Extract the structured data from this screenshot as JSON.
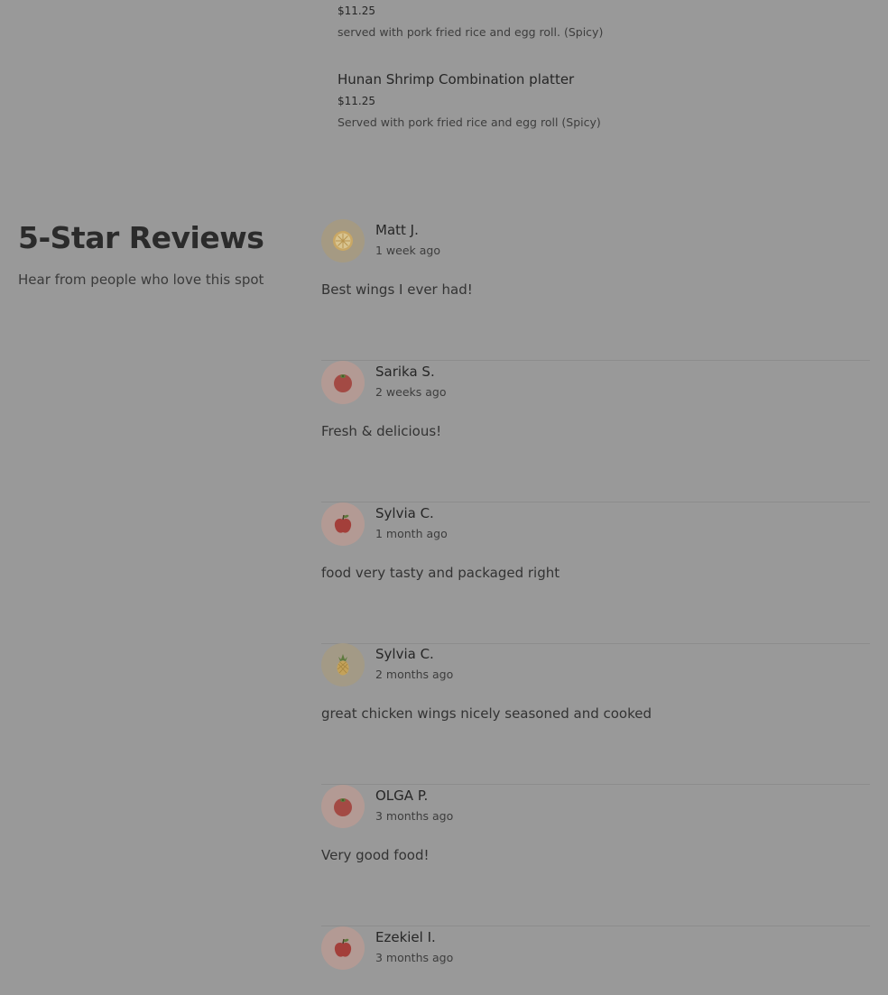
{
  "menu_items": [
    {
      "name": "",
      "price": "$11.25",
      "description": "served with pork fried rice and egg roll. (Spicy)"
    },
    {
      "name": "Hunan Shrimp Combination platter",
      "price": "$11.25",
      "description": "Served with pork fried rice and egg roll (Spicy)"
    }
  ],
  "reviews_section": {
    "title": "5-Star Reviews",
    "subtitle": "Hear from people who love this spot",
    "reviews": [
      {
        "name": "Matt J.",
        "date": "1 week ago",
        "text": "Best wings I ever had!",
        "avatar_icon": "lemon-icon"
      },
      {
        "name": "Sarika S.",
        "date": "2 weeks ago",
        "text": "Fresh & delicious!",
        "avatar_icon": "tomato-icon"
      },
      {
        "name": "Sylvia C.",
        "date": "1 month ago",
        "text": "food very tasty and packaged right",
        "avatar_icon": "apple-icon"
      },
      {
        "name": "Sylvia C.",
        "date": "2 months ago",
        "text": "great chicken wings nicely seasoned and cooked",
        "avatar_icon": "pineapple-icon"
      },
      {
        "name": "OLGA P.",
        "date": "3 months ago",
        "text": "Very good food!",
        "avatar_icon": "tomato-icon"
      },
      {
        "name": "Ezekiel I.",
        "date": "3 months ago",
        "text": "",
        "avatar_icon": "apple-icon"
      }
    ]
  }
}
